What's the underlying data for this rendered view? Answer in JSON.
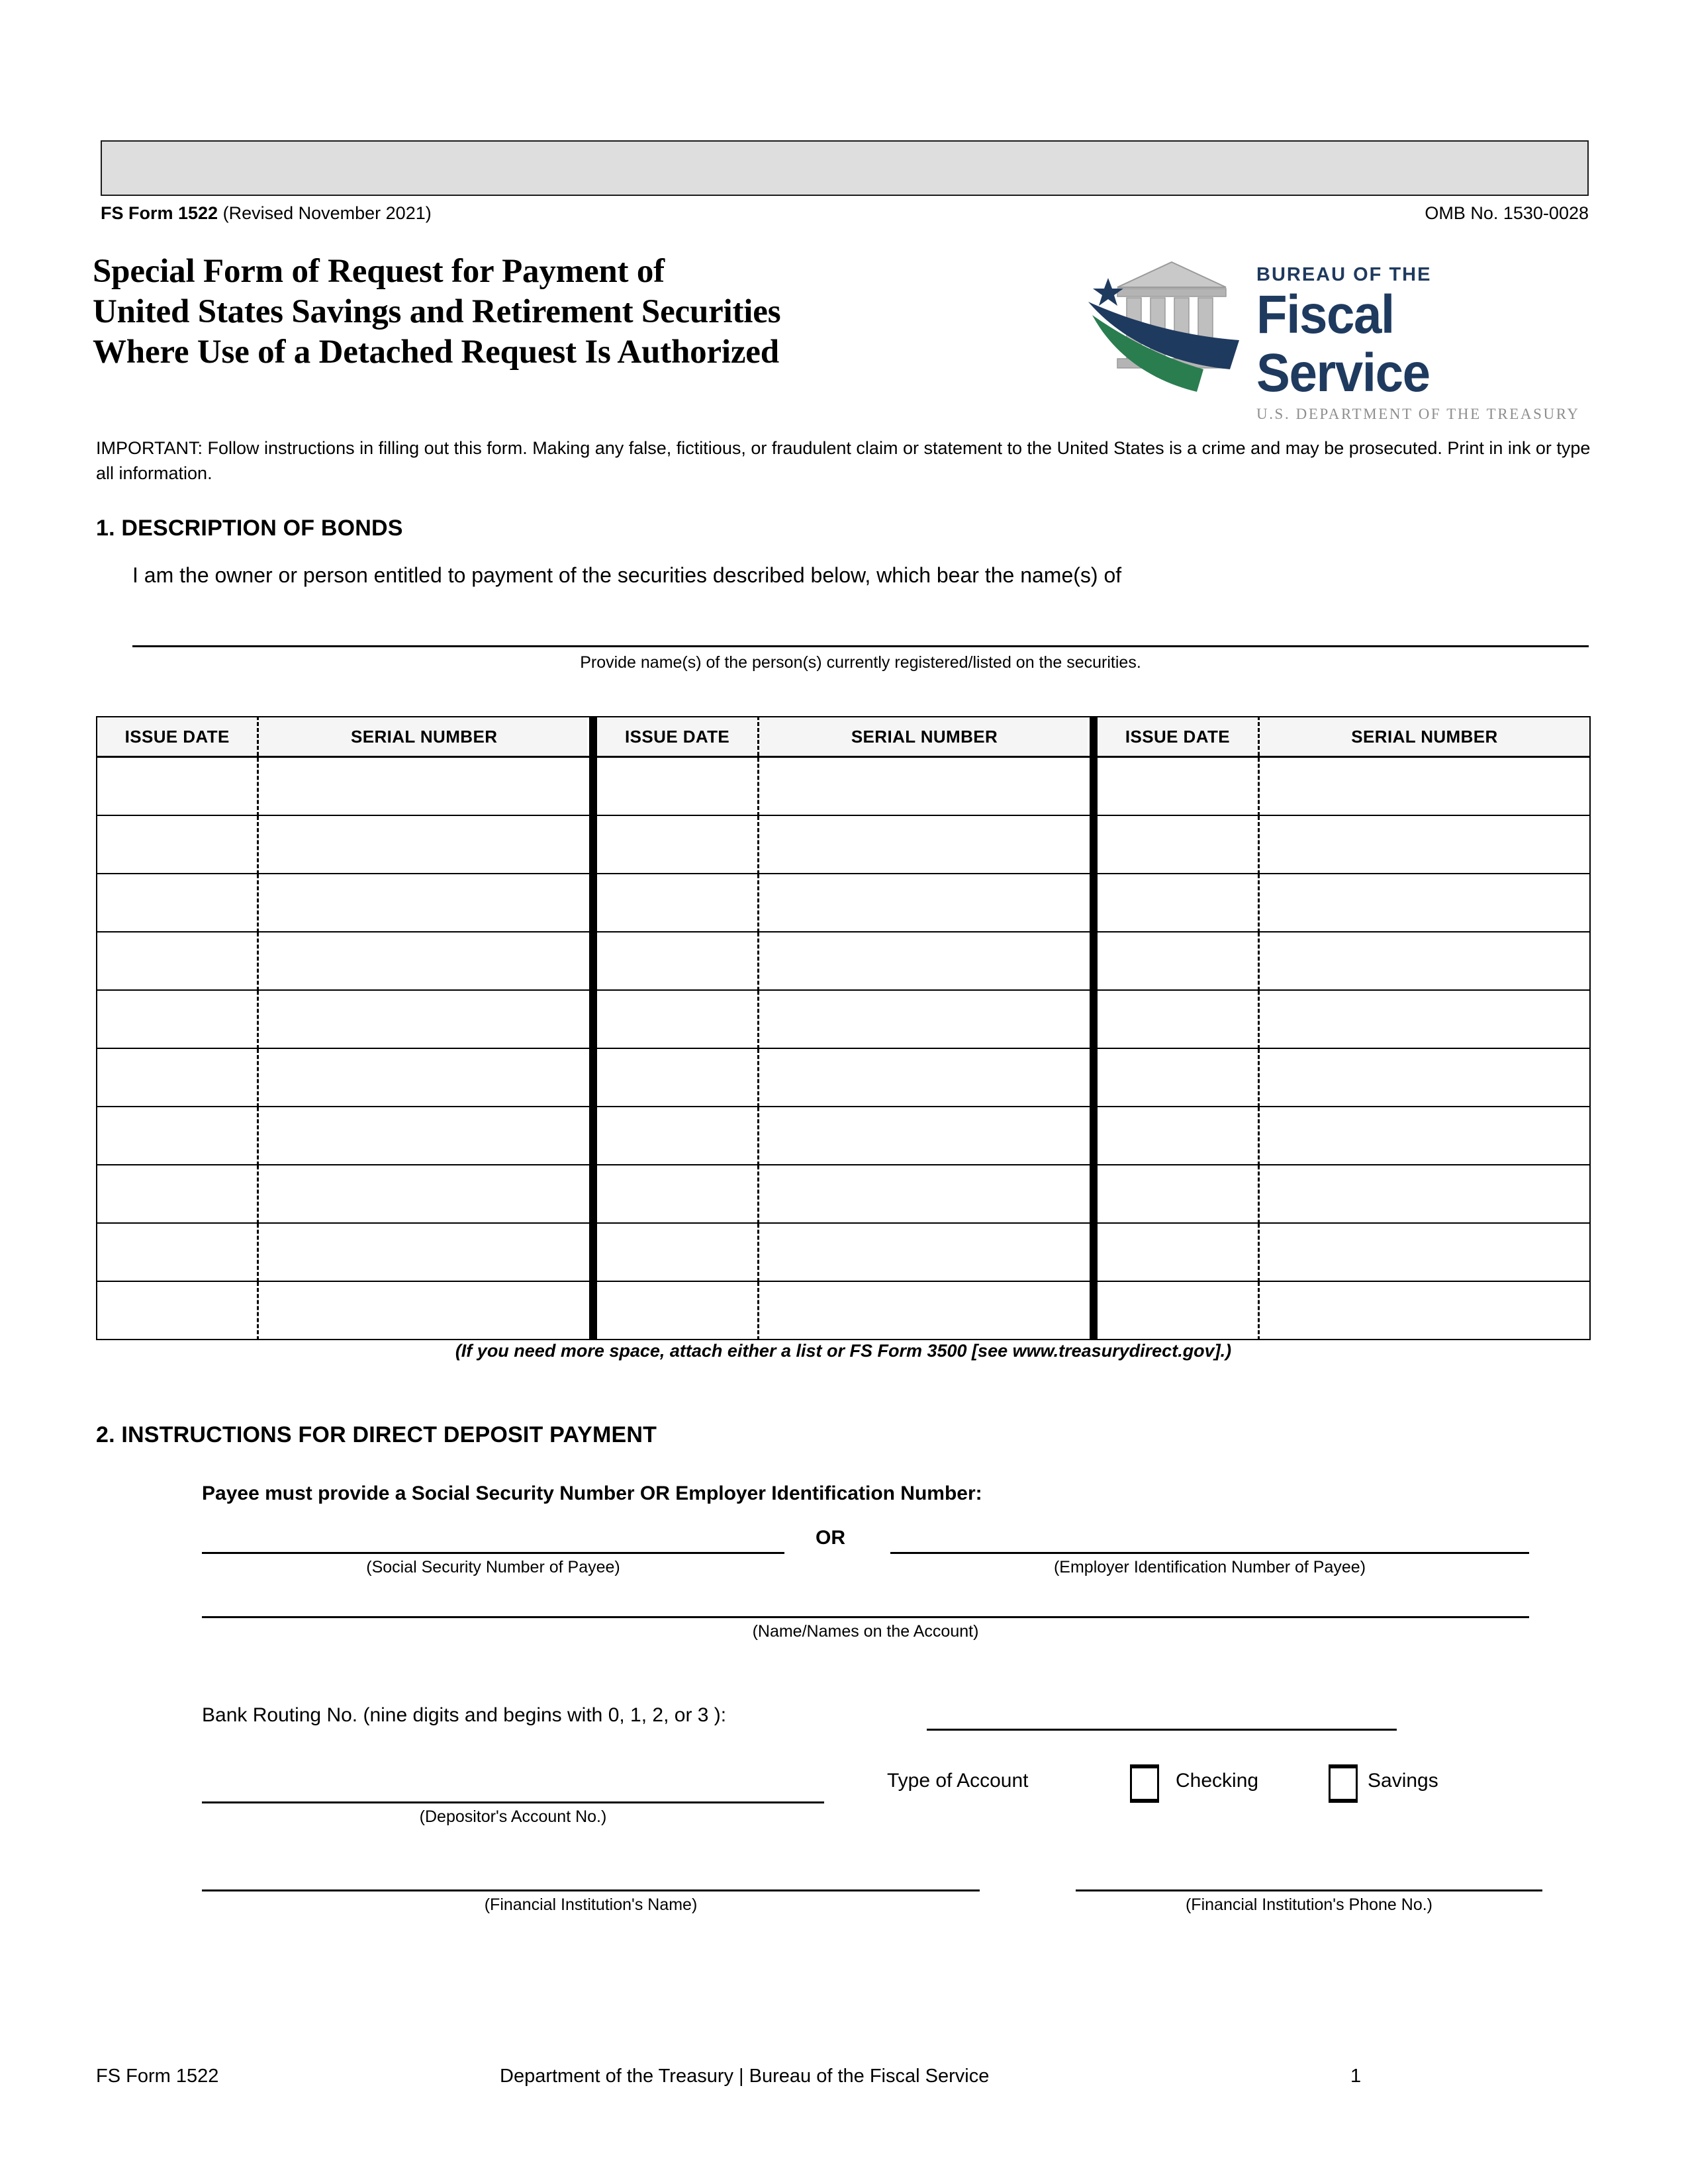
{
  "document": {
    "form_id_bold": "FS Form 1522",
    "form_id_rest": " (Revised November 2021)",
    "omb": "OMB No. 1530-0028",
    "title_line1": "Special Form of Request for Payment of",
    "title_line2": "United States Savings and Retirement Securities",
    "title_line3": "Where Use of a Detached Request Is Authorized",
    "important": "IMPORTANT:  Follow instructions in filling out this form.  Making any false, fictitious, or fraudulent claim or statement to the United States is a crime and may be prosecuted.  Print in ink or type all information."
  },
  "logo": {
    "bureau": "BUREAU OF THE",
    "fiscal": "Fiscal Service",
    "dept": "U.S. DEPARTMENT OF THE TREASURY",
    "navy": "#1f3a5f",
    "green": "#2a7d4f",
    "gray": "#b4b4b4"
  },
  "section1": {
    "heading": "1. DESCRIPTION OF BONDS",
    "intro": "I am the owner or person entitled to payment of the securities described below, which bear the name(s) of",
    "name_caption": "Provide name(s) of the person(s) currently registered/listed on the securities.",
    "table": {
      "headers": [
        "ISSUE DATE",
        "SERIAL NUMBER",
        "ISSUE DATE",
        "SERIAL NUMBER",
        "ISSUE DATE",
        "SERIAL NUMBER"
      ],
      "row_count": 10,
      "rows": [
        [
          "",
          "",
          "",
          "",
          "",
          ""
        ],
        [
          "",
          "",
          "",
          "",
          "",
          ""
        ],
        [
          "",
          "",
          "",
          "",
          "",
          ""
        ],
        [
          "",
          "",
          "",
          "",
          "",
          ""
        ],
        [
          "",
          "",
          "",
          "",
          "",
          ""
        ],
        [
          "",
          "",
          "",
          "",
          "",
          ""
        ],
        [
          "",
          "",
          "",
          "",
          "",
          ""
        ],
        [
          "",
          "",
          "",
          "",
          "",
          ""
        ],
        [
          "",
          "",
          "",
          "",
          "",
          ""
        ],
        [
          "",
          "",
          "",
          "",
          "",
          ""
        ]
      ]
    },
    "table_note": "(If you need more space, attach either a list or FS Form 3500 [see www.treasurydirect.gov].)"
  },
  "section2": {
    "heading": "2. INSTRUCTIONS FOR DIRECT DEPOSIT PAYMENT",
    "payee_requirement": "Payee must provide a Social Security Number OR Employer Identification Number:",
    "or_label": "OR",
    "ssn_caption": "(Social Security Number of Payee)",
    "ein_caption": "(Employer Identification Number of Payee)",
    "account_name_caption": "(Name/Names on the Account)",
    "routing_label": "Bank Routing No. (nine digits and begins with 0, 1, 2, or 3 ):",
    "depositor_account_caption": "(Depositor's Account No.)",
    "type_of_account_label": "Type of Account",
    "checking_label": "Checking",
    "savings_label": "Savings",
    "institution_name_caption": "(Financial Institution's Name)",
    "institution_phone_caption": "(Financial Institution's Phone No.)",
    "values": {
      "ssn": "",
      "ein": "",
      "account_name": "",
      "routing_no": "",
      "depositor_account_no": "",
      "institution_name": "",
      "institution_phone": "",
      "checking_checked": false,
      "savings_checked": false
    }
  },
  "footer": {
    "left": "FS Form 1522",
    "center": "Department of the Treasury | Bureau of the Fiscal Service",
    "right": "1"
  }
}
